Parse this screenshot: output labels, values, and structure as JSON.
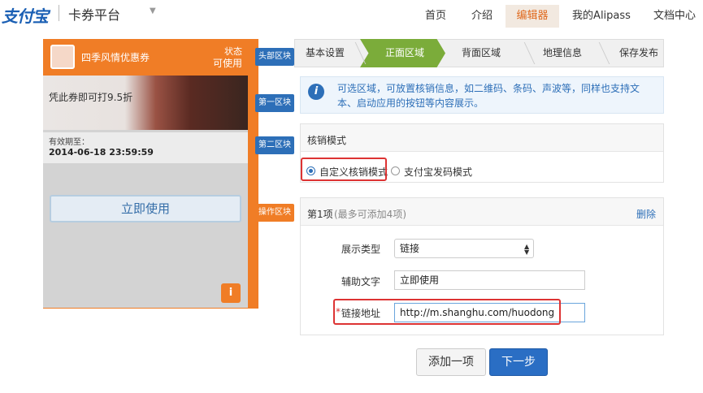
{
  "header": {
    "logo": "支付宝",
    "platform": "卡券平台",
    "nav": [
      "首页",
      "介绍",
      "编辑器",
      "我的Alipass",
      "文档中心"
    ]
  },
  "preview": {
    "title": "四季风情优惠券",
    "status_label": "状态",
    "status_value": "可使用",
    "image_text": "凭此券即可打9.5折",
    "valid_label": "有效期至：",
    "valid_date": "2014-06-18 23:59:59",
    "use_button": "立即使用",
    "info_icon": "i"
  },
  "tags": [
    "头部区块",
    "第一区块",
    "第二区块",
    "操作区块"
  ],
  "steps": [
    "基本设置",
    "正面区域",
    "背面区域",
    "地理信息",
    "保存发布"
  ],
  "info": {
    "icon": "i",
    "text": "可选区域，可放置核销信息，如二维码、条码、声波等，同样也支持文本、启动应用的按钮等内容展示。"
  },
  "verify": {
    "title": "核销模式",
    "option1": "自定义核销模式",
    "option2": "支付宝发码模式"
  },
  "item": {
    "title": "第1项",
    "hint": "(最多可添加4项)",
    "delete": "删除",
    "type_label": "展示类型",
    "type_value": "链接",
    "aux_label": "辅助文字",
    "aux_value": "立即使用",
    "link_label": "链接地址",
    "link_value": "http://m.shanghu.com/huodong",
    "required_mark": "*"
  },
  "buttons": {
    "add": "添加一项",
    "next": "下一步"
  }
}
